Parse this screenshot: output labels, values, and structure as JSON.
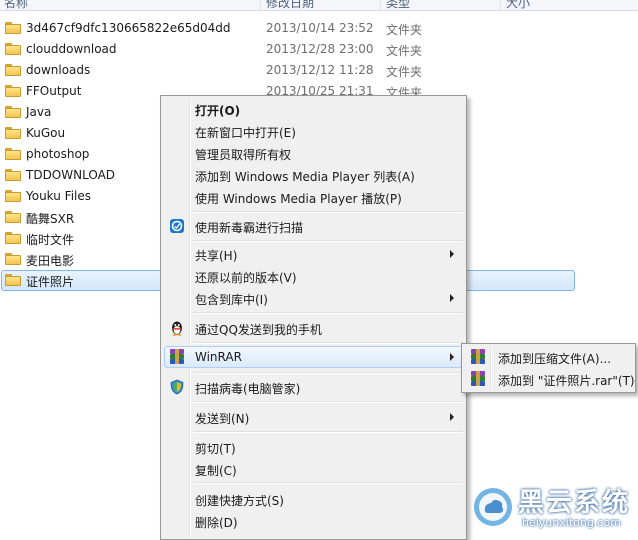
{
  "header": {
    "columns": [
      "名称",
      "修改日期",
      "类型",
      "大小"
    ]
  },
  "files": [
    {
      "name": "3d467cf9dfc130665822e65d04dd",
      "date": "2013/10/14 23:52",
      "type": "文件夹"
    },
    {
      "name": "clouddownload",
      "date": "2013/12/28 23:00",
      "type": "文件夹"
    },
    {
      "name": "downloads",
      "date": "2013/12/12 11:28",
      "type": "文件夹"
    },
    {
      "name": "FFOutput",
      "date": "2013/10/25 21:31",
      "type": "文件夹"
    },
    {
      "name": "Java",
      "date": "",
      "type": ""
    },
    {
      "name": "KuGou",
      "date": "",
      "type": ""
    },
    {
      "name": "photoshop",
      "date": "",
      "type": ""
    },
    {
      "name": "TDDOWNLOAD",
      "date": "",
      "type": ""
    },
    {
      "name": "Youku Files",
      "date": "",
      "type": ""
    },
    {
      "name": "酷舞SXR",
      "date": "",
      "type": ""
    },
    {
      "name": "临时文件",
      "date": "",
      "type": ""
    },
    {
      "name": "麦田电影",
      "date": "",
      "type": ""
    },
    {
      "name": "证件照片",
      "date": "",
      "type": ""
    }
  ],
  "context_menu": {
    "items": [
      {
        "label": "打开(O)"
      },
      {
        "label": "在新窗口中打开(E)"
      },
      {
        "label": "管理员取得所有权"
      },
      {
        "label": "添加到 Windows Media Player 列表(A)"
      },
      {
        "label": "使用 Windows Media Player 播放(P)"
      },
      {
        "label": "使用新毒霸进行扫描"
      },
      {
        "label": "共享(H)"
      },
      {
        "label": "还原以前的版本(V)"
      },
      {
        "label": "包含到库中(I)"
      },
      {
        "label": "通过QQ发送到我的手机"
      },
      {
        "label": "WinRAR"
      },
      {
        "label": "扫描病毒(电脑管家)"
      },
      {
        "label": "发送到(N)"
      },
      {
        "label": "剪切(T)"
      },
      {
        "label": "复制(C)"
      },
      {
        "label": "创建快捷方式(S)"
      },
      {
        "label": "删除(D)"
      }
    ]
  },
  "winrar_submenu": {
    "items": [
      {
        "label": "添加到压缩文件(A)..."
      },
      {
        "label": "添加到 \"证件照片.rar\"(T)"
      }
    ]
  },
  "watermark": {
    "title": "黑云系统",
    "url": "heiyunxitong.com"
  },
  "colors": {
    "selection_border": "#86b5e8",
    "menu_background": "#f0f0f0",
    "folder_yellow": "#f3c44f"
  }
}
